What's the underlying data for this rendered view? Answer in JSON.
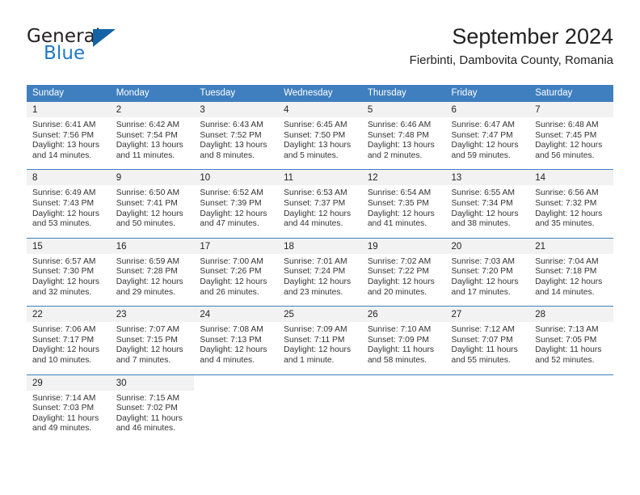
{
  "brand": {
    "name_part1": "General",
    "name_part2": "Blue",
    "triangle_color": "#1464a5",
    "blue_color": "#1f7ac4"
  },
  "header": {
    "month_title": "September 2024",
    "location": "Fierbinti, Dambovita County, Romania"
  },
  "theme": {
    "header_bg": "#3f7fbf",
    "daynum_bg": "#f2f2f2",
    "text": "#222222"
  },
  "calendar": {
    "weekday_headers": [
      "Sunday",
      "Monday",
      "Tuesday",
      "Wednesday",
      "Thursday",
      "Friday",
      "Saturday"
    ],
    "weeks": [
      [
        {
          "day": "1",
          "sunrise": "Sunrise: 6:41 AM",
          "sunset": "Sunset: 7:56 PM",
          "daylight1": "Daylight: 13 hours",
          "daylight2": "and 14 minutes."
        },
        {
          "day": "2",
          "sunrise": "Sunrise: 6:42 AM",
          "sunset": "Sunset: 7:54 PM",
          "daylight1": "Daylight: 13 hours",
          "daylight2": "and 11 minutes."
        },
        {
          "day": "3",
          "sunrise": "Sunrise: 6:43 AM",
          "sunset": "Sunset: 7:52 PM",
          "daylight1": "Daylight: 13 hours",
          "daylight2": "and 8 minutes."
        },
        {
          "day": "4",
          "sunrise": "Sunrise: 6:45 AM",
          "sunset": "Sunset: 7:50 PM",
          "daylight1": "Daylight: 13 hours",
          "daylight2": "and 5 minutes."
        },
        {
          "day": "5",
          "sunrise": "Sunrise: 6:46 AM",
          "sunset": "Sunset: 7:48 PM",
          "daylight1": "Daylight: 13 hours",
          "daylight2": "and 2 minutes."
        },
        {
          "day": "6",
          "sunrise": "Sunrise: 6:47 AM",
          "sunset": "Sunset: 7:47 PM",
          "daylight1": "Daylight: 12 hours",
          "daylight2": "and 59 minutes."
        },
        {
          "day": "7",
          "sunrise": "Sunrise: 6:48 AM",
          "sunset": "Sunset: 7:45 PM",
          "daylight1": "Daylight: 12 hours",
          "daylight2": "and 56 minutes."
        }
      ],
      [
        {
          "day": "8",
          "sunrise": "Sunrise: 6:49 AM",
          "sunset": "Sunset: 7:43 PM",
          "daylight1": "Daylight: 12 hours",
          "daylight2": "and 53 minutes."
        },
        {
          "day": "9",
          "sunrise": "Sunrise: 6:50 AM",
          "sunset": "Sunset: 7:41 PM",
          "daylight1": "Daylight: 12 hours",
          "daylight2": "and 50 minutes."
        },
        {
          "day": "10",
          "sunrise": "Sunrise: 6:52 AM",
          "sunset": "Sunset: 7:39 PM",
          "daylight1": "Daylight: 12 hours",
          "daylight2": "and 47 minutes."
        },
        {
          "day": "11",
          "sunrise": "Sunrise: 6:53 AM",
          "sunset": "Sunset: 7:37 PM",
          "daylight1": "Daylight: 12 hours",
          "daylight2": "and 44 minutes."
        },
        {
          "day": "12",
          "sunrise": "Sunrise: 6:54 AM",
          "sunset": "Sunset: 7:35 PM",
          "daylight1": "Daylight: 12 hours",
          "daylight2": "and 41 minutes."
        },
        {
          "day": "13",
          "sunrise": "Sunrise: 6:55 AM",
          "sunset": "Sunset: 7:34 PM",
          "daylight1": "Daylight: 12 hours",
          "daylight2": "and 38 minutes."
        },
        {
          "day": "14",
          "sunrise": "Sunrise: 6:56 AM",
          "sunset": "Sunset: 7:32 PM",
          "daylight1": "Daylight: 12 hours",
          "daylight2": "and 35 minutes."
        }
      ],
      [
        {
          "day": "15",
          "sunrise": "Sunrise: 6:57 AM",
          "sunset": "Sunset: 7:30 PM",
          "daylight1": "Daylight: 12 hours",
          "daylight2": "and 32 minutes."
        },
        {
          "day": "16",
          "sunrise": "Sunrise: 6:59 AM",
          "sunset": "Sunset: 7:28 PM",
          "daylight1": "Daylight: 12 hours",
          "daylight2": "and 29 minutes."
        },
        {
          "day": "17",
          "sunrise": "Sunrise: 7:00 AM",
          "sunset": "Sunset: 7:26 PM",
          "daylight1": "Daylight: 12 hours",
          "daylight2": "and 26 minutes."
        },
        {
          "day": "18",
          "sunrise": "Sunrise: 7:01 AM",
          "sunset": "Sunset: 7:24 PM",
          "daylight1": "Daylight: 12 hours",
          "daylight2": "and 23 minutes."
        },
        {
          "day": "19",
          "sunrise": "Sunrise: 7:02 AM",
          "sunset": "Sunset: 7:22 PM",
          "daylight1": "Daylight: 12 hours",
          "daylight2": "and 20 minutes."
        },
        {
          "day": "20",
          "sunrise": "Sunrise: 7:03 AM",
          "sunset": "Sunset: 7:20 PM",
          "daylight1": "Daylight: 12 hours",
          "daylight2": "and 17 minutes."
        },
        {
          "day": "21",
          "sunrise": "Sunrise: 7:04 AM",
          "sunset": "Sunset: 7:18 PM",
          "daylight1": "Daylight: 12 hours",
          "daylight2": "and 14 minutes."
        }
      ],
      [
        {
          "day": "22",
          "sunrise": "Sunrise: 7:06 AM",
          "sunset": "Sunset: 7:17 PM",
          "daylight1": "Daylight: 12 hours",
          "daylight2": "and 10 minutes."
        },
        {
          "day": "23",
          "sunrise": "Sunrise: 7:07 AM",
          "sunset": "Sunset: 7:15 PM",
          "daylight1": "Daylight: 12 hours",
          "daylight2": "and 7 minutes."
        },
        {
          "day": "24",
          "sunrise": "Sunrise: 7:08 AM",
          "sunset": "Sunset: 7:13 PM",
          "daylight1": "Daylight: 12 hours",
          "daylight2": "and 4 minutes."
        },
        {
          "day": "25",
          "sunrise": "Sunrise: 7:09 AM",
          "sunset": "Sunset: 7:11 PM",
          "daylight1": "Daylight: 12 hours",
          "daylight2": "and 1 minute."
        },
        {
          "day": "26",
          "sunrise": "Sunrise: 7:10 AM",
          "sunset": "Sunset: 7:09 PM",
          "daylight1": "Daylight: 11 hours",
          "daylight2": "and 58 minutes."
        },
        {
          "day": "27",
          "sunrise": "Sunrise: 7:12 AM",
          "sunset": "Sunset: 7:07 PM",
          "daylight1": "Daylight: 11 hours",
          "daylight2": "and 55 minutes."
        },
        {
          "day": "28",
          "sunrise": "Sunrise: 7:13 AM",
          "sunset": "Sunset: 7:05 PM",
          "daylight1": "Daylight: 11 hours",
          "daylight2": "and 52 minutes."
        }
      ],
      [
        {
          "day": "29",
          "sunrise": "Sunrise: 7:14 AM",
          "sunset": "Sunset: 7:03 PM",
          "daylight1": "Daylight: 11 hours",
          "daylight2": "and 49 minutes."
        },
        {
          "day": "30",
          "sunrise": "Sunrise: 7:15 AM",
          "sunset": "Sunset: 7:02 PM",
          "daylight1": "Daylight: 11 hours",
          "daylight2": "and 46 minutes."
        },
        {
          "day": "",
          "sunrise": "",
          "sunset": "",
          "daylight1": "",
          "daylight2": ""
        },
        {
          "day": "",
          "sunrise": "",
          "sunset": "",
          "daylight1": "",
          "daylight2": ""
        },
        {
          "day": "",
          "sunrise": "",
          "sunset": "",
          "daylight1": "",
          "daylight2": ""
        },
        {
          "day": "",
          "sunrise": "",
          "sunset": "",
          "daylight1": "",
          "daylight2": ""
        },
        {
          "day": "",
          "sunrise": "",
          "sunset": "",
          "daylight1": "",
          "daylight2": ""
        }
      ]
    ]
  }
}
